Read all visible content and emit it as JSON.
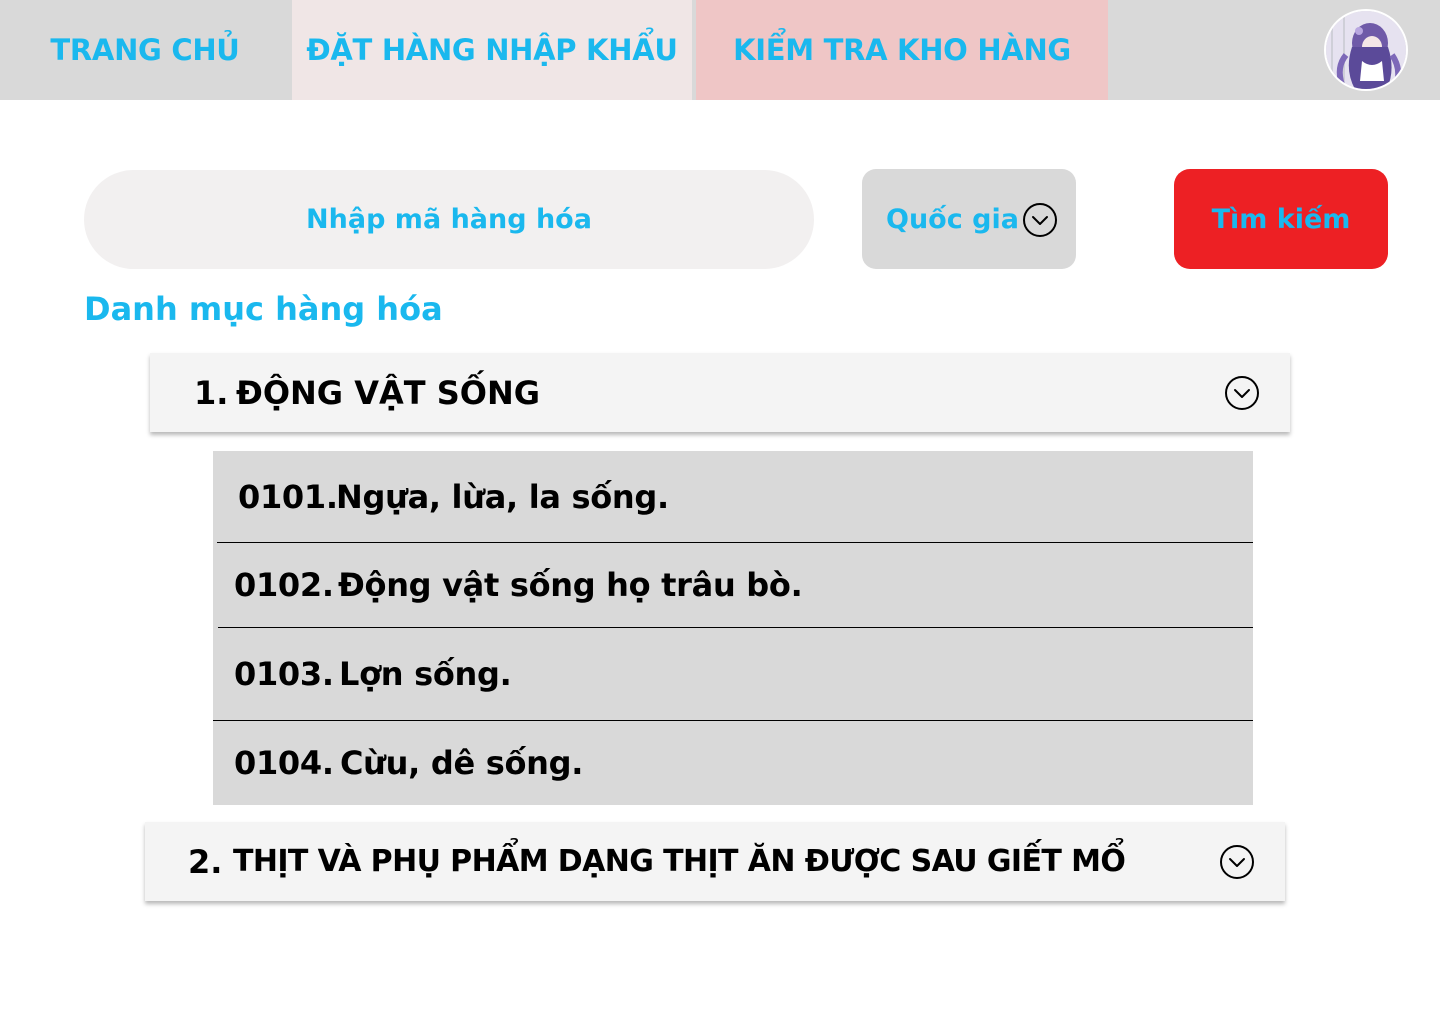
{
  "nav": {
    "tabs": [
      {
        "label": "TRANG CHỦ"
      },
      {
        "label": "ĐẶT HÀNG NHẬP KHẨU"
      },
      {
        "label": "KIỂM TRA KHO HÀNG"
      }
    ],
    "avatar_icon": "user-avatar-icon"
  },
  "search": {
    "placeholder": "Nhập mã hàng hóa",
    "value": "",
    "country_label": "Quốc gia",
    "button_label": "Tìm kiếm"
  },
  "catalog": {
    "title": "Danh mục hàng hóa",
    "categories": [
      {
        "number": "1.",
        "label": "ĐỘNG VẬT SỐNG",
        "expanded": true,
        "items": [
          {
            "code": "0101.",
            "name": "Ngựa, lừa, la sống."
          },
          {
            "code": "0102.",
            "name": "Động vật sống họ trâu bò."
          },
          {
            "code": "0103.",
            "name": "Lợn sống."
          },
          {
            "code": "0104.",
            "name": "Cừu, dê sống."
          }
        ]
      },
      {
        "number": "2.",
        "label": "THỊT VÀ PHỤ PHẨM DẠNG THỊT ĂN ĐƯỢC SAU GIẾT MỔ",
        "expanded": false,
        "items": []
      }
    ]
  },
  "colors": {
    "accent_text": "#1ab8ee",
    "nav_bg": "#d9d9d9",
    "tab_order_bg": "#f0e6e6",
    "tab_stock_bg": "#efc6c6",
    "search_button_bg": "#ed2024",
    "list_bg": "#d9d9d9"
  }
}
